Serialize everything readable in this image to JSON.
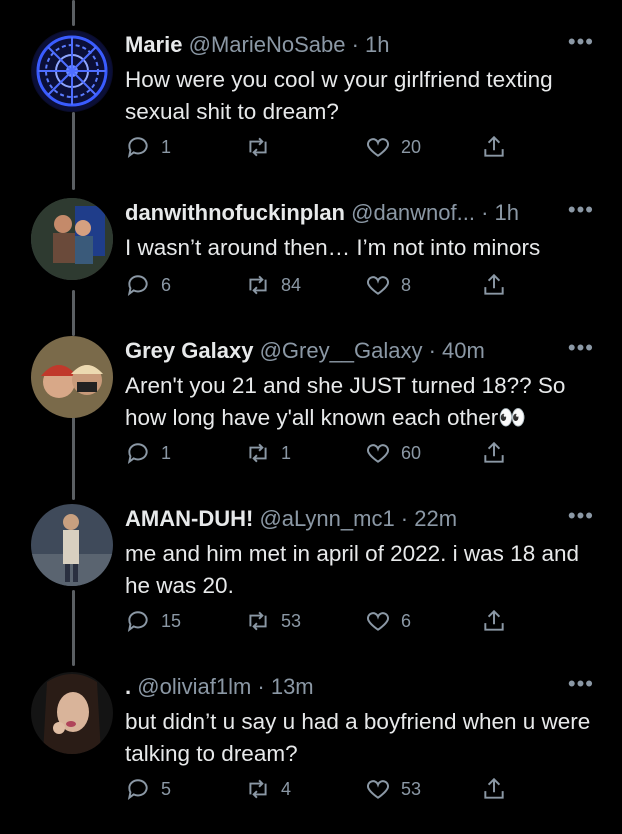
{
  "tweets": [
    {
      "name": "Marie",
      "handle": "@MarieNoSabe · 1h",
      "text": "How were you cool w your girlfriend texting sexual shit to dream?",
      "replies": "1",
      "retweets": "",
      "likes": "20"
    },
    {
      "name": "danwithnofuckinplan",
      "handle": "@danwnof... · 1h",
      "text": "I wasn’t around then… I’m not into minors",
      "replies": "6",
      "retweets": "84",
      "likes": "8"
    },
    {
      "name": "Grey Galaxy",
      "handle": "@Grey__Galaxy · 40m",
      "text": "Aren't you 21 and she JUST turned 18?? So how long have y'all known each other👀",
      "replies": "1",
      "retweets": "1",
      "likes": "60"
    },
    {
      "name": "AMAN-DUH!",
      "handle": "@aLynn_mc1 · 22m",
      "text": "me and him met in april of 2022. i was 18 and he was 20.",
      "replies": "15",
      "retweets": "53",
      "likes": "6"
    },
    {
      "name": ".",
      "handle": "@oliviaf1lm · 13m",
      "text": "but didn’t u say u had a boyfriend when u were talking to dream?",
      "replies": "5",
      "retweets": "4",
      "likes": "53"
    }
  ],
  "more_label": "•••",
  "icons": {
    "reply": "reply-icon",
    "retweet": "retweet-icon",
    "like": "heart-icon",
    "share": "share-icon"
  }
}
